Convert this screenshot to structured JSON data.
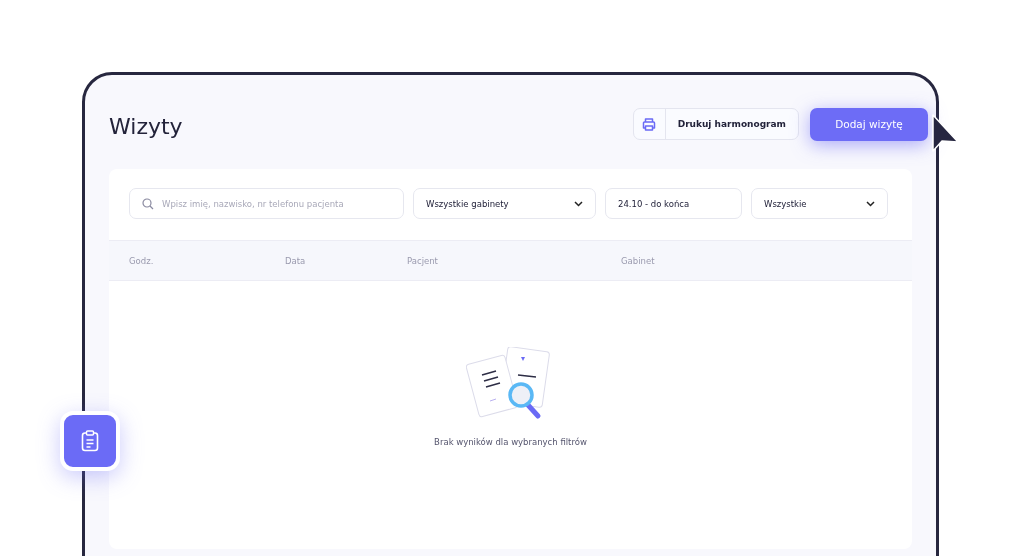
{
  "page": {
    "title": "Wizyty"
  },
  "actions": [
    {
      "kind": "secondary",
      "label": "Drukuj harmonogram"
    },
    {
      "kind": "primary",
      "label": "Dodaj wizytę"
    }
  ],
  "filters": [
    {
      "kind": "search",
      "placeholder": "Wpisz imię, nazwisko, nr telefonu pacjenta"
    },
    {
      "kind": "dropdown",
      "value": "Wszystkie gabinety"
    },
    {
      "kind": "date",
      "value": "24.10 - do końca"
    },
    {
      "kind": "dropdown",
      "value": "Wszystkie"
    }
  ],
  "table": {
    "columns": [
      "Godz.",
      "Data",
      "Pacjent",
      "Gabinet"
    ],
    "empty_message": "Brak wyników dla wybranych filtrów"
  }
}
